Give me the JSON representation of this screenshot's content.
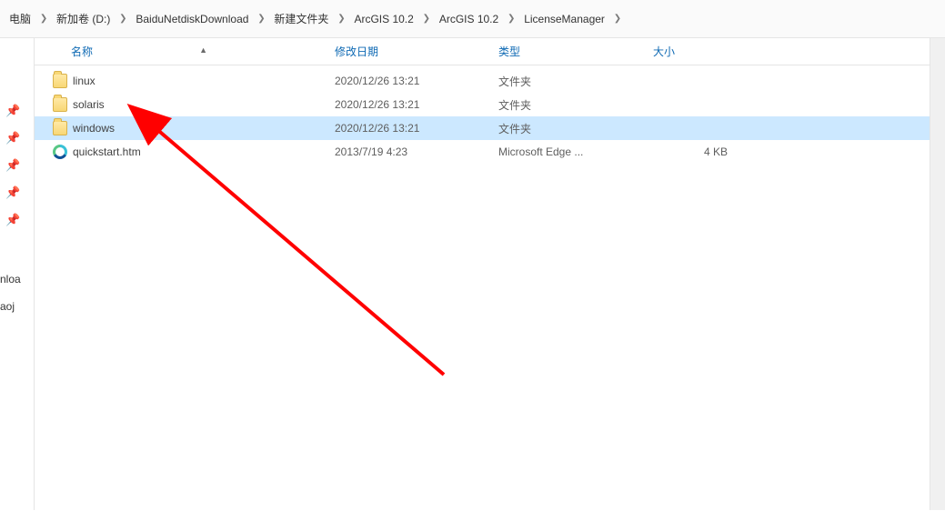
{
  "breadcrumb": [
    {
      "label": "电脑"
    },
    {
      "label": "新加卷 (D:)"
    },
    {
      "label": "BaiduNetdiskDownload"
    },
    {
      "label": "新建文件夹"
    },
    {
      "label": "ArcGIS 10.2"
    },
    {
      "label": "ArcGIS 10.2"
    },
    {
      "label": "LicenseManager"
    }
  ],
  "columns": {
    "name": "名称",
    "date": "修改日期",
    "type": "类型",
    "size": "大小"
  },
  "items": [
    {
      "name": "linux",
      "date": "2020/12/26 13:21",
      "type": "文件夹",
      "size": "",
      "icon": "folder",
      "selected": false
    },
    {
      "name": "solaris",
      "date": "2020/12/26 13:21",
      "type": "文件夹",
      "size": "",
      "icon": "folder",
      "selected": false
    },
    {
      "name": "windows",
      "date": "2020/12/26 13:21",
      "type": "文件夹",
      "size": "",
      "icon": "folder",
      "selected": true
    },
    {
      "name": "quickstart.htm",
      "date": "2013/7/19 4:23",
      "type": "Microsoft Edge ...",
      "size": "4 KB",
      "icon": "edge",
      "selected": false
    }
  ],
  "quick_access_fragments": {
    "a": "nloa",
    "b": "aoj"
  }
}
